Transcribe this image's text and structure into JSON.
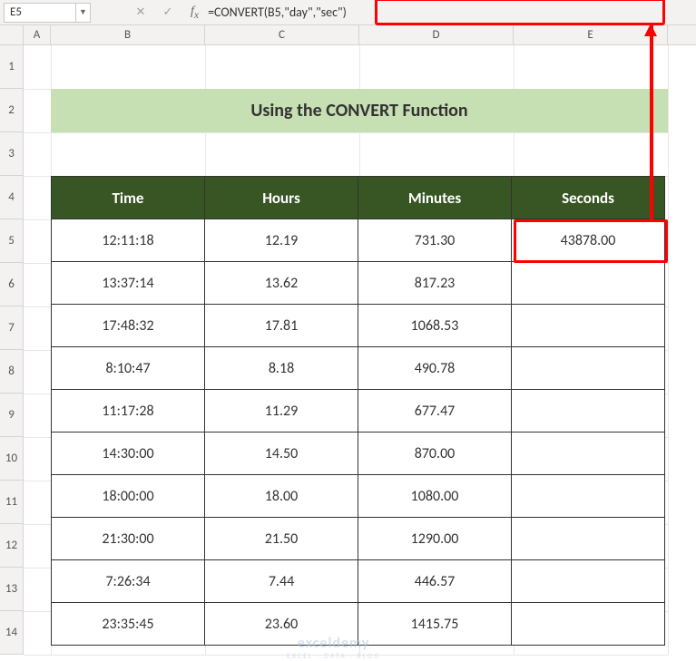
{
  "nameBox": "E5",
  "formulaBar": "=CONVERT(B5,\"day\",\"sec\")",
  "columns": [
    "A",
    "B",
    "C",
    "D",
    "E"
  ],
  "rows": [
    "1",
    "2",
    "3",
    "4",
    "5",
    "6",
    "7",
    "8",
    "9",
    "10",
    "11",
    "12",
    "13",
    "14"
  ],
  "title": "Using the CONVERT Function",
  "headers": {
    "time": "Time",
    "hours": "Hours",
    "minutes": "Minutes",
    "seconds": "Seconds"
  },
  "data": [
    {
      "time": "12:11:18",
      "hours": "12.19",
      "minutes": "731.30",
      "seconds": "43878.00"
    },
    {
      "time": "13:37:14",
      "hours": "13.62",
      "minutes": "817.23",
      "seconds": ""
    },
    {
      "time": "17:48:32",
      "hours": "17.81",
      "minutes": "1068.53",
      "seconds": ""
    },
    {
      "time": "8:10:47",
      "hours": "8.18",
      "minutes": "490.78",
      "seconds": ""
    },
    {
      "time": "11:17:28",
      "hours": "11.29",
      "minutes": "677.47",
      "seconds": ""
    },
    {
      "time": "14:30:00",
      "hours": "14.50",
      "minutes": "870.00",
      "seconds": ""
    },
    {
      "time": "18:00:00",
      "hours": "18.00",
      "minutes": "1080.00",
      "seconds": ""
    },
    {
      "time": "21:30:00",
      "hours": "21.50",
      "minutes": "1290.00",
      "seconds": ""
    },
    {
      "time": "7:26:34",
      "hours": "7.44",
      "minutes": "446.57",
      "seconds": ""
    },
    {
      "time": "23:35:45",
      "hours": "23.60",
      "minutes": "1415.75",
      "seconds": ""
    }
  ],
  "watermark": {
    "line1": "exceldemy",
    "line2": "EXCEL · DATA · BLOG"
  }
}
